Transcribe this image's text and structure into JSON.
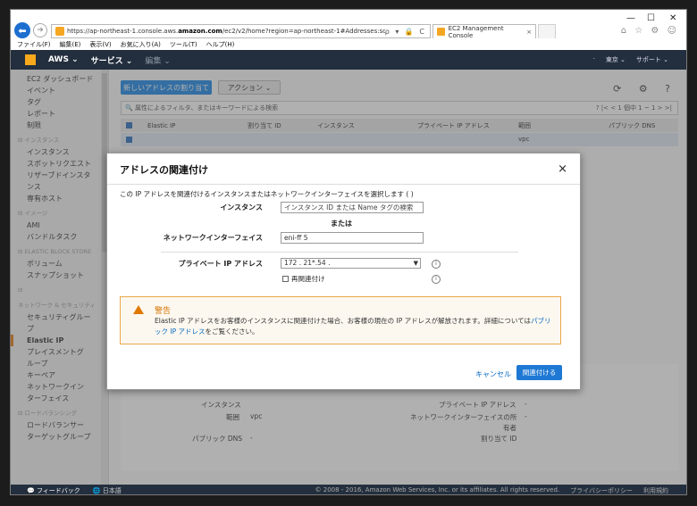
{
  "browser": {
    "url_prefix": "https://ap-northeast-1.console.aws.",
    "url_bold": "amazon.com",
    "url_rest": "/ec2/v2/home?region=ap-northeast-1#Addresses:sort=publicIp",
    "url_icons": "ρ ▾ 🔒 C",
    "tab_title": "EC2 Management Console",
    "tab_close": "×",
    "window_controls": [
      "—",
      "☐",
      "✕"
    ],
    "toolbar_icons": "⌂ ☆ ⚙ ☺",
    "menu": [
      "ファイル(F)",
      "編集(E)",
      "表示(V)",
      "お気に入り(A)",
      "ツール(T)",
      "ヘルプ(H)"
    ]
  },
  "awsnav": {
    "aws": "AWS ⌄",
    "services": "サービス ⌄",
    "edit": "編集 ⌄",
    "region": "東京 ⌄",
    "support": "サポート ⌄",
    "dot": "·"
  },
  "sidebar": {
    "items": [
      {
        "type": "item",
        "label": "EC2 ダッシュボード"
      },
      {
        "type": "item",
        "label": "イベント"
      },
      {
        "type": "item",
        "label": "タグ"
      },
      {
        "type": "item",
        "label": "レポート"
      },
      {
        "type": "item",
        "label": "制限"
      },
      {
        "type": "group",
        "label": "⊟ インスタンス"
      },
      {
        "type": "item",
        "label": "インスタンス"
      },
      {
        "type": "item",
        "label": "スポットリクエスト"
      },
      {
        "type": "item",
        "label": "リザーブドインスタ"
      },
      {
        "type": "item",
        "label": "ンス"
      },
      {
        "type": "item",
        "label": "専有ホスト"
      },
      {
        "type": "group",
        "label": "⊟ イメージ"
      },
      {
        "type": "item",
        "label": "AMI"
      },
      {
        "type": "item",
        "label": "バンドルタスク"
      },
      {
        "type": "group",
        "label": "⊟ ELASTIC BLOCK STORE"
      },
      {
        "type": "item",
        "label": "ボリューム"
      },
      {
        "type": "item",
        "label": "スナップショット"
      },
      {
        "type": "group",
        "label": "⊟"
      },
      {
        "type": "group",
        "label": "ネットワーク & セキュリティ"
      },
      {
        "type": "item",
        "label": "セキュリティグルー"
      },
      {
        "type": "item",
        "label": "プ"
      },
      {
        "type": "active",
        "label": "Elastic IP"
      },
      {
        "type": "item",
        "label": "プレイスメントグ"
      },
      {
        "type": "item",
        "label": "ループ"
      },
      {
        "type": "item",
        "label": "キーペア"
      },
      {
        "type": "item",
        "label": "ネットワークイン"
      },
      {
        "type": "item",
        "label": "ターフェイス"
      },
      {
        "type": "group",
        "label": "⊟ ロードバランシング"
      },
      {
        "type": "item",
        "label": "ロードバランサー"
      },
      {
        "type": "item",
        "label": "ターゲットグループ"
      }
    ]
  },
  "main": {
    "new_address": "新しいアドレスの割り当て",
    "actions": "アクション ⌄",
    "top_icons": "⟳ ⚙ ?",
    "filter_placeholder": "🔍 属性によるフィルタ、またはキーワードによる検索",
    "pager": "?  |<  <  1 個中 1 ~ 1  >  >|",
    "columns": [
      "Elastic IP",
      "割り当て ID",
      "インスタンス",
      "プライベート IP アドレス",
      "範囲",
      "パブリック DNS"
    ],
    "row_scope": "vpc",
    "detail": {
      "instance_label": "インスタンス",
      "scope_label": "範囲",
      "scope_value": "vpc",
      "dns_label": "パブリック DNS",
      "dns_value": "-",
      "private_ip_label": "プライベート IP アドレス",
      "private_ip_value": "-",
      "eni_owner_label_1": "ネットワークインターフェイスの所",
      "eni_owner_label_2": "有者",
      "eni_owner_value": "-",
      "alloc_label": "割り当て ID"
    }
  },
  "modal": {
    "title": "アドレスの関連付け",
    "close": "×",
    "description": "この IP アドレスを関連付けるインスタンスまたはネットワークインターフェイスを選択します (                    )",
    "instance_label": "インスタンス",
    "instance_placeholder": "インスタンス ID または Name タグの検索",
    "or": "または",
    "eni_label": "ネットワークインターフェイス",
    "eni_value": "eni-ff          5",
    "private_ip_label": "プライベート IP アドレス",
    "private_ip_value": "172       .    21*.54       .",
    "reassoc_label": "再関連付け",
    "info": "i",
    "warning_title": "警告",
    "warning_text": "Elastic IP アドレスをお客様のインスタンスに関連付けた場合、お客様の現在の IP アドレスが解放されます。詳細については",
    "warning_link": "パブリック IP アドレス",
    "warning_after": "をご覧ください。",
    "cancel": "キャンセル",
    "associate": "関連付ける"
  },
  "footer": {
    "feedback": "💬 フィードバック",
    "language": "🌐 日本語",
    "copyright": "© 2008 - 2016, Amazon Web Services, Inc. or its affiliates. All rights reserved.",
    "privacy": "プライバシーポリシー",
    "terms": "利用規約"
  }
}
